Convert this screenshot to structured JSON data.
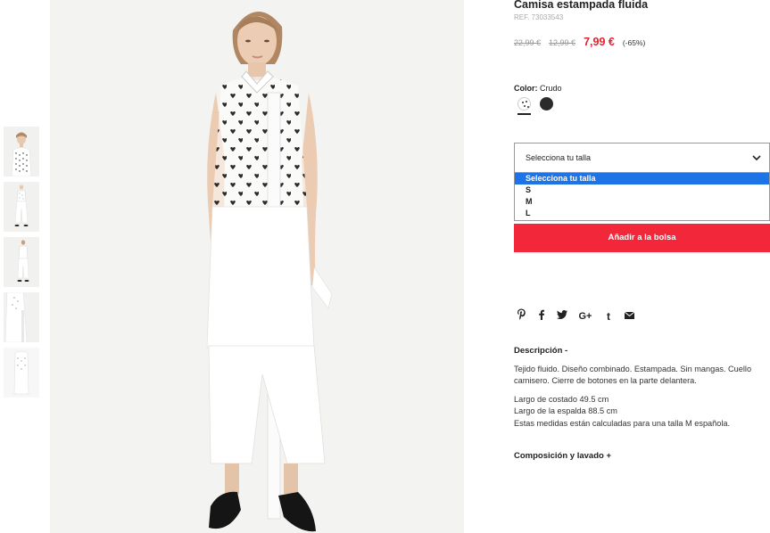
{
  "product": {
    "title": "Camisa estampada fluida",
    "ref": "REF. 73033543",
    "price_original": "22,99 €",
    "price_previous": "12,99 €",
    "price_current": "7,99 €",
    "discount": "(-65%)"
  },
  "color": {
    "label": "Color:",
    "value": "Crudo",
    "swatches": [
      {
        "name": "Crudo",
        "color": "#ffffff",
        "selected": true
      },
      {
        "name": "Negro",
        "color": "#2b2b2b",
        "selected": false
      }
    ]
  },
  "size": {
    "select_value": "Selecciona tu talla",
    "options": [
      "Selecciona tu talla",
      "S",
      "M",
      "L"
    ],
    "highlighted_option": "Selecciona tu talla"
  },
  "actions": {
    "add_to_bag": "Añadir a la bolsa"
  },
  "share": {
    "icons": [
      "pinterest-icon",
      "facebook-icon",
      "twitter-icon",
      "google-plus-icon",
      "tumblr-icon",
      "email-icon"
    ],
    "glyphs": [
      "℗",
      "f",
      "🐦",
      "G+",
      "t",
      "✉"
    ]
  },
  "description": {
    "heading": "Descripción  -",
    "paragraph1": "Tejido fluido. Diseño combinado. Estampada. Sin mangas. Cuello camisero. Cierre de botones en la parte delantera.",
    "line_length": "Largo de costado 49.5 cm",
    "line_back": "Largo de la espalda 88.5 cm",
    "line_note": "Estas medidas están calculadas para una talla M española."
  },
  "composition": {
    "heading": "Composición y lavado  +"
  },
  "colors": {
    "accent_red": "#f2283a",
    "price_red": "#e4222e",
    "select_highlight": "#1e74e6"
  }
}
